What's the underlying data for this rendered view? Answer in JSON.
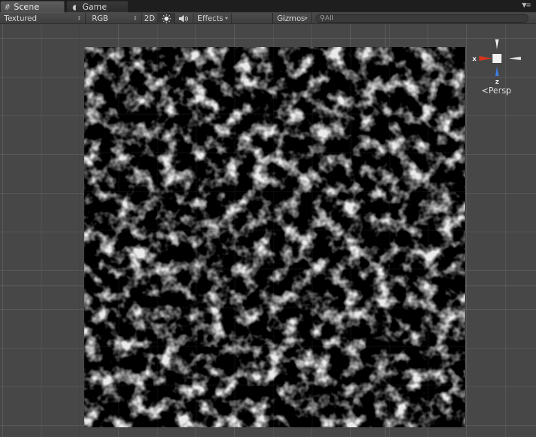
{
  "tabs": [
    {
      "label": "Scene",
      "icon": "grid-icon",
      "active": true
    },
    {
      "label": "Game",
      "icon": "pacman-icon",
      "active": false
    }
  ],
  "toolbar": {
    "draw_mode": "Textured",
    "render_mode": "RGB",
    "mode_2d": "2D",
    "lighting_icon": "sun-icon",
    "audio_icon": "speaker-icon",
    "effects": "Effects",
    "gizmos": "Gizmos",
    "search_placeholder": "All"
  },
  "gizmo": {
    "x_label": "x",
    "z_label": "z",
    "projection": "Persp",
    "colors": {
      "x": "#d8341e",
      "z": "#3f7ae0",
      "neutral": "#e8e8e8"
    }
  },
  "scene": {
    "object": "noise-texture-plane",
    "noise_colors": {
      "background": "#000000",
      "blob": "#ffffff"
    }
  }
}
